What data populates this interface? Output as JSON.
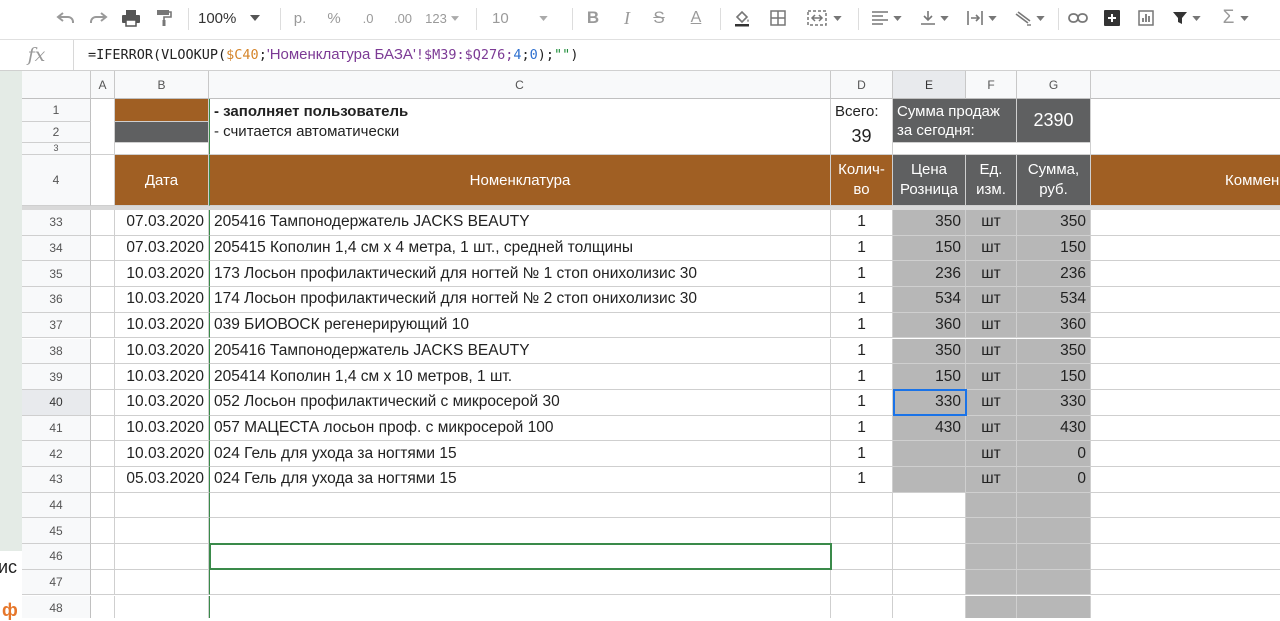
{
  "toolbar": {
    "zoom": "100%",
    "currency": "р.",
    "percent": "%",
    "dec_less": ".0",
    "dec_more": ".00",
    "number_format": "123",
    "font_size": "10",
    "bold": "B",
    "italic": "I",
    "strike": "S",
    "text_color": "A",
    "sum": "Σ"
  },
  "formula": {
    "fx": "fx",
    "p1": "=IFERROR(VLOOKUP(",
    "ref1": "$C40",
    "p2": ";",
    "sheet": "'Номенклатура БАЗА'",
    "p3": "!$M39:$Q276;",
    "num1": "4",
    "p4": ";",
    "num2": "0",
    "p5": ");",
    "str": "\"\"",
    "p6": ")"
  },
  "columns": [
    "A",
    "B",
    "C",
    "D",
    "E",
    "F",
    "G"
  ],
  "legend": {
    "user_fill": "- заполняет пользователь",
    "auto_calc": "- считается автоматически",
    "total_label": "Всего:",
    "total_value": "39",
    "sales_label_1": "Сумма продаж",
    "sales_label_2": "за сегодня:",
    "sales_value": "2390"
  },
  "headers": {
    "date": "Дата",
    "item": "Номенклатура",
    "qty_1": "Колич-",
    "qty_2": "во",
    "price_1": "Цена",
    "price_2": "Розница",
    "unit_1": "Ед.",
    "unit_2": "изм.",
    "sum_1": "Сумма,",
    "sum_2": "руб.",
    "comment": "Коммен"
  },
  "top_rows": [
    "1",
    "2",
    "3",
    "4"
  ],
  "rows": [
    {
      "n": "33",
      "date": "07.03.2020",
      "item": "205416 Тампонодержатель JACKS BEAUTY",
      "qty": "1",
      "price": "350",
      "unit": "шт",
      "sum": "350"
    },
    {
      "n": "34",
      "date": "07.03.2020",
      "item": "205415 Кополин 1,4 см х 4 метра, 1 шт., средней толщины",
      "qty": "1",
      "price": "150",
      "unit": "шт",
      "sum": "150"
    },
    {
      "n": "35",
      "date": "10.03.2020",
      "item": "173 Лосьон профилактический для ногтей № 1 стоп онихолизис 30",
      "qty": "1",
      "price": "236",
      "unit": "шт",
      "sum": "236"
    },
    {
      "n": "36",
      "date": "10.03.2020",
      "item": "174 Лосьон профилактический для ногтей № 2 стоп онихолизис 30",
      "qty": "1",
      "price": "534",
      "unit": "шт",
      "sum": "534"
    },
    {
      "n": "37",
      "date": "10.03.2020",
      "item": "039 БИОВОСК регенерирующий 10",
      "qty": "1",
      "price": "360",
      "unit": "шт",
      "sum": "360"
    },
    {
      "n": "38",
      "date": "10.03.2020",
      "item": "205416 Тампонодержатель JACKS BEAUTY",
      "qty": "1",
      "price": "350",
      "unit": "шт",
      "sum": "350"
    },
    {
      "n": "39",
      "date": "10.03.2020",
      "item": "205414 Кополин 1,4 см х 10 метров, 1 шт.",
      "qty": "1",
      "price": "150",
      "unit": "шт",
      "sum": "150"
    },
    {
      "n": "40",
      "date": "10.03.2020",
      "item": "052 Лосьон профилактический с микросерой 30",
      "qty": "1",
      "price": "330",
      "unit": "шт",
      "sum": "330"
    },
    {
      "n": "41",
      "date": "10.03.2020",
      "item": "057 МАЦЕСТА  лосьон проф. с микросерой  100",
      "qty": "1",
      "price": "430",
      "unit": "шт",
      "sum": "430"
    },
    {
      "n": "42",
      "date": "10.03.2020",
      "item": "024 Гель  для ухода за ногтями   15",
      "qty": "1",
      "price": "",
      "unit": "шт",
      "sum": "0"
    },
    {
      "n": "43",
      "date": "05.03.2020",
      "item": "024 Гель  для ухода за ногтями   15",
      "qty": "1",
      "price": "",
      "unit": "шт",
      "sum": "0"
    },
    {
      "n": "44",
      "date": "",
      "item": "",
      "qty": "",
      "price": "",
      "unit": "",
      "sum": ""
    },
    {
      "n": "45",
      "date": "",
      "item": "",
      "qty": "",
      "price": "",
      "unit": "",
      "sum": ""
    },
    {
      "n": "46",
      "date": "",
      "item": "",
      "qty": "",
      "price": "",
      "unit": "",
      "sum": ""
    },
    {
      "n": "47",
      "date": "",
      "item": "",
      "qty": "",
      "price": "",
      "unit": "",
      "sum": ""
    },
    {
      "n": "48",
      "date": "",
      "item": "",
      "qty": "",
      "price": "",
      "unit": "",
      "sum": ""
    }
  ],
  "left_fragment": {
    "text1": "ис",
    "text2": "ф"
  }
}
